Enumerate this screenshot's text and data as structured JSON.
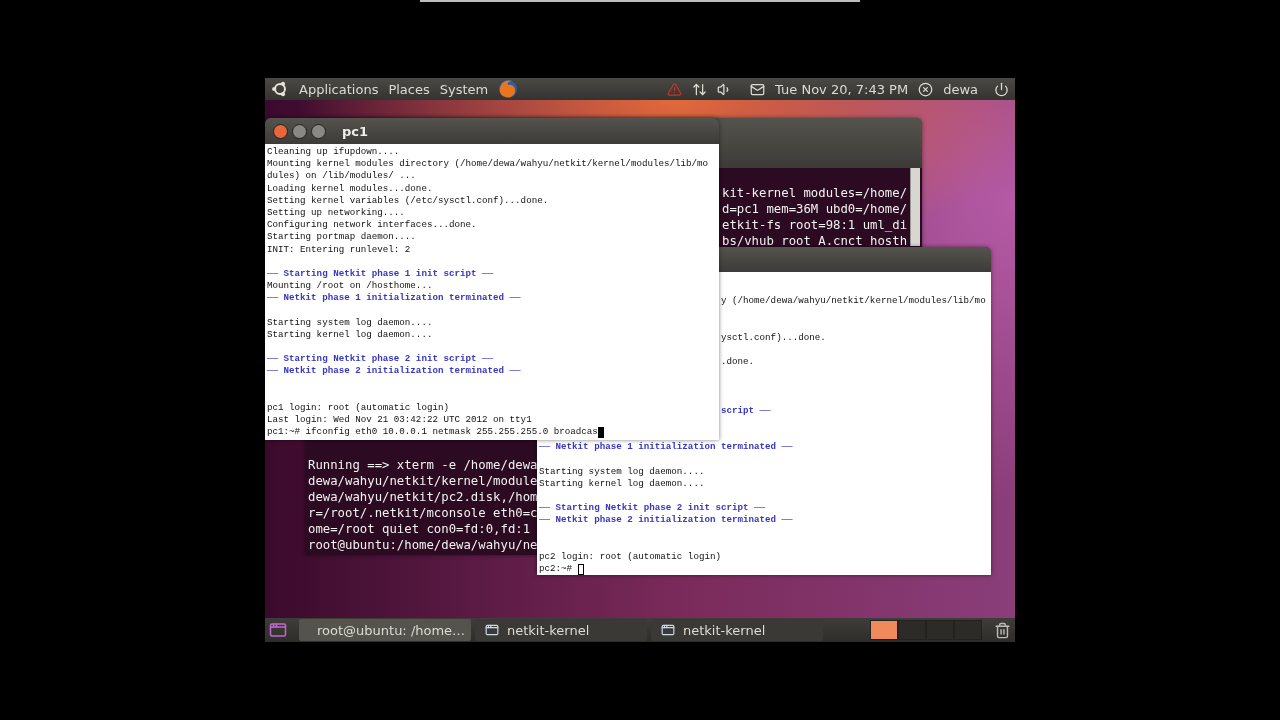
{
  "top_panel": {
    "menus": [
      "Applications",
      "Places",
      "System"
    ],
    "clock": "Tue Nov 20, 7:43 PM",
    "user": "dewa"
  },
  "background_terminal": {
    "top_right_lines": [
      "kit-kernel modules=/home/",
      "d=pc1 mem=36M ubd0=/home/",
      "etkit-fs root=98:1 uml_di",
      "bs/vhub_root_A.cnct hosth"
    ],
    "bottom_left_lines": [
      "Running ==> xterm -e /home/dewa",
      "dewa/wahyu/netkit/kernel/module",
      "dewa/wahyu/netkit/pc2.disk,/hom",
      "r=/root/.netkit/mconsole eth0=c",
      "ome=/root quiet con0=fd:0,fd:1",
      "root@ubuntu:/home/dewa/wahyu/ne"
    ]
  },
  "pc1": {
    "title": "pc1",
    "cursor_filled": true,
    "lines": [
      {
        "kind": "plain",
        "text": "Cleaning up ifupdown...."
      },
      {
        "kind": "plain",
        "text": "Mounting kernel modules directory (/home/dewa/wahyu/netkit/kernel/modules/lib/mo"
      },
      {
        "kind": "plain",
        "text": "dules) on /lib/modules/ ..."
      },
      {
        "kind": "plain",
        "text": "Loading kernel modules...done."
      },
      {
        "kind": "plain",
        "text": "Setting kernel variables (/etc/sysctl.conf)...done."
      },
      {
        "kind": "plain",
        "text": "Setting up networking...."
      },
      {
        "kind": "plain",
        "text": "Configuring network interfaces...done."
      },
      {
        "kind": "plain",
        "text": "Starting portmap daemon...."
      },
      {
        "kind": "plain",
        "text": "INIT: Entering runlevel: 2"
      },
      {
        "kind": "blank"
      },
      {
        "kind": "banner",
        "text": "── Starting Netkit phase 1 init script ──"
      },
      {
        "kind": "plain",
        "text": "Mounting /root on /hosthome..."
      },
      {
        "kind": "banner",
        "text": "── Netkit phase 1 initialization terminated ──"
      },
      {
        "kind": "blank"
      },
      {
        "kind": "plain",
        "text": "Starting system log daemon...."
      },
      {
        "kind": "plain",
        "text": "Starting kernel log daemon...."
      },
      {
        "kind": "blank"
      },
      {
        "kind": "banner",
        "text": "── Starting Netkit phase 2 init script ──"
      },
      {
        "kind": "banner",
        "text": "── Netkit phase 2 initialization terminated ──"
      },
      {
        "kind": "blank"
      },
      {
        "kind": "blank"
      },
      {
        "kind": "plain",
        "text": "pc1 login: root (automatic login)"
      },
      {
        "kind": "plain",
        "text": "Last login: Wed Nov 21 03:42:22 UTC 2012 on tty1"
      },
      {
        "kind": "plain",
        "text": "pc1:~# ifconfig eth0 10.0.0.1 netmask 255.255.255.0 broadcas"
      }
    ]
  },
  "pc2": {
    "cursor_filled": false,
    "peek_lines": [
      {
        "kind": "plain",
        "text": "y (/home/dewa/wahyu/netkit/kernel/modules/lib/mo"
      },
      {
        "kind": "blank"
      },
      {
        "kind": "blank"
      },
      {
        "kind": "plain",
        "text": "ysctl.conf)...done."
      },
      {
        "kind": "blank"
      },
      {
        "kind": "plain",
        "text": ".done."
      },
      {
        "kind": "blank"
      },
      {
        "kind": "blank"
      },
      {
        "kind": "blank"
      },
      {
        "kind": "banner",
        "text": "script ──"
      },
      {
        "kind": "blank"
      },
      {
        "kind": "blank"
      }
    ],
    "lines": [
      {
        "kind": "banner",
        "text": "── Netkit phase 1 initialization terminated ──"
      },
      {
        "kind": "blank"
      },
      {
        "kind": "plain",
        "text": "Starting system log daemon...."
      },
      {
        "kind": "plain",
        "text": "Starting kernel log daemon...."
      },
      {
        "kind": "blank"
      },
      {
        "kind": "banner",
        "text": "── Starting Netkit phase 2 init script ──"
      },
      {
        "kind": "banner",
        "text": "── Netkit phase 2 initialization terminated ──"
      },
      {
        "kind": "blank"
      },
      {
        "kind": "blank"
      },
      {
        "kind": "plain",
        "text": "pc2 login: root (automatic login)"
      },
      {
        "kind": "plain",
        "text": "pc2:~# "
      }
    ]
  },
  "taskbar": {
    "tasks": [
      {
        "kind": "terminal",
        "label": "root@ubuntu: /home…",
        "selected": true
      },
      {
        "kind": "window",
        "label": "netkit-kernel",
        "selected": false
      },
      {
        "kind": "window",
        "label": "netkit-kernel",
        "selected": false
      }
    ],
    "workspaces": [
      {
        "selected": true
      },
      {
        "selected": false
      },
      {
        "selected": false
      },
      {
        "selected": false
      }
    ]
  }
}
